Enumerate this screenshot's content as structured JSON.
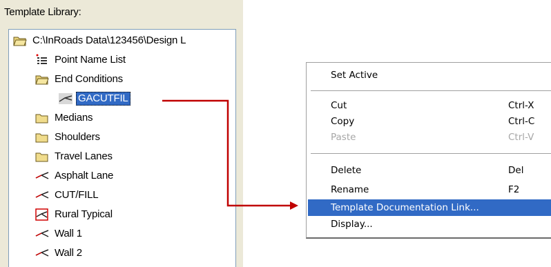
{
  "library": {
    "title": "Template Library:",
    "items": [
      {
        "label": "C:\\InRoads Data\\123456\\Design L",
        "icon": "folder-open-icon"
      },
      {
        "label": "Point Name List",
        "icon": "point-list-icon"
      },
      {
        "label": "End Conditions",
        "icon": "folder-open-icon"
      },
      {
        "label": "GACUTFIL",
        "icon": "end-condition-template-icon",
        "selected": true
      },
      {
        "label": "Medians",
        "icon": "folder-closed-icon"
      },
      {
        "label": "Shoulders",
        "icon": "folder-closed-icon"
      },
      {
        "label": "Travel Lanes",
        "icon": "folder-closed-icon"
      },
      {
        "label": "Asphalt Lane",
        "icon": "template-icon"
      },
      {
        "label": "CUT/FILL",
        "icon": "template-icon"
      },
      {
        "label": "Rural Typical",
        "icon": "active-template-icon"
      },
      {
        "label": "Wall 1",
        "icon": "template-icon"
      },
      {
        "label": "Wall 2",
        "icon": "template-icon"
      }
    ]
  },
  "context_menu": {
    "items": [
      {
        "label": "Set Active",
        "shortcut": ""
      },
      {
        "label": "Cut",
        "shortcut": "Ctrl-X"
      },
      {
        "label": "Copy",
        "shortcut": "Ctrl-C"
      },
      {
        "label": "Paste",
        "shortcut": "Ctrl-V",
        "disabled": true
      },
      {
        "label": "Delete",
        "shortcut": "Del"
      },
      {
        "label": "Rename",
        "shortcut": "F2"
      },
      {
        "label": "Template Documentation Link...",
        "shortcut": "",
        "highlighted": true
      },
      {
        "label": "Display...",
        "shortcut": ""
      }
    ]
  },
  "colors": {
    "selection": "#316ac5",
    "connector": "#c00000",
    "panel_background": "#ece9d8"
  }
}
